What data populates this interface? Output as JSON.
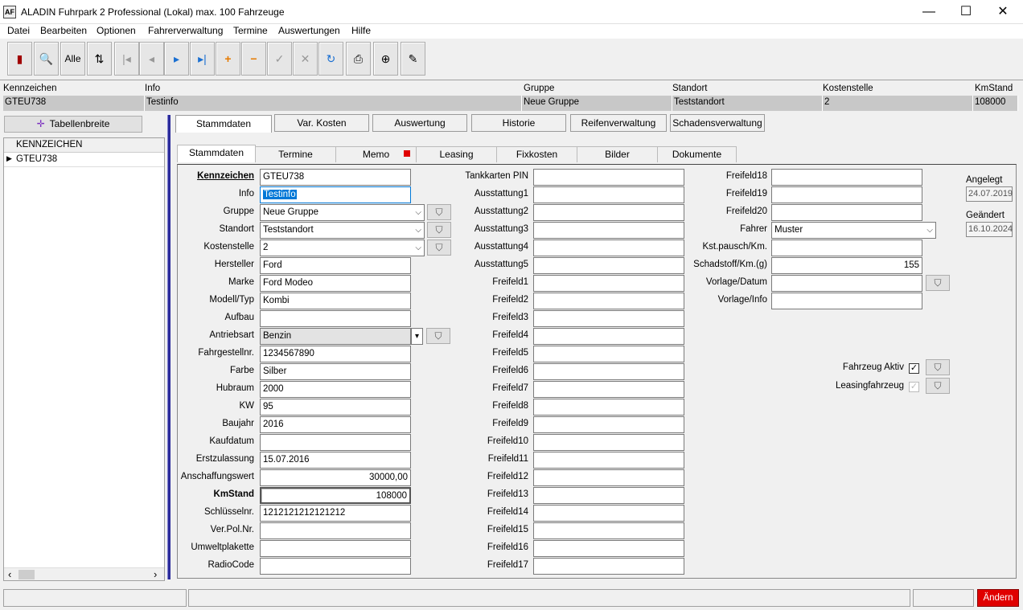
{
  "window": {
    "logo": "AF",
    "title": "ALADIN Fuhrpark 2 Professional (Lokal)  max. 100 Fahrzeuge",
    "min_icon": "—",
    "max_icon": "☐",
    "close_icon": "✕"
  },
  "menu": [
    "Datei",
    "Bearbeiten",
    "Optionen",
    "Fahrerverwaltung",
    "Termine",
    "Auswertungen",
    "Hilfe"
  ],
  "toolbar": {
    "exit_icon": "▮",
    "search_icon": "🔍",
    "all_label": "Alle",
    "sort_icon": "⇅",
    "first_icon": "|◂",
    "prev_icon": "◂",
    "next_icon": "▸",
    "last_icon": "▸|",
    "add_icon": "+",
    "remove_icon": "−",
    "confirm_icon": "✓",
    "cancel_icon": "✕",
    "refresh_icon": "↻",
    "print_icon": "⎙",
    "zoom_icon": "⊕",
    "edit_icon": "✎"
  },
  "header": {
    "labels": [
      "Kennzeichen",
      "Info",
      "Gruppe",
      "Standort",
      "Kostenstelle",
      "KmStand"
    ],
    "values": [
      "GTEU738",
      "Testinfo",
      "Neue Gruppe",
      "Teststandort",
      "2",
      "108000"
    ]
  },
  "left": {
    "tabwidth_label": "Tabellenbreite",
    "tabwidth_icon": "✛",
    "grid_header": "KENNZEICHEN",
    "rows": [
      "GTEU738"
    ],
    "row_marker": "▶",
    "scroll_left": "‹",
    "scroll_right": "›"
  },
  "top_tabs": [
    "Stammdaten",
    "Var. Kosten",
    "Auswertung",
    "Historie",
    "Reifenverwaltung",
    "Schadensverwaltung"
  ],
  "sub_tabs": [
    "Stammdaten",
    "Termine",
    "Memo",
    "Leasing",
    "Fixkosten",
    "Bilder",
    "Dokumente"
  ],
  "col1": [
    {
      "label": "Kennzeichen",
      "value": "GTEU738"
    },
    {
      "label": "Info",
      "value": "Testinfo"
    },
    {
      "label": "Gruppe",
      "value": "Neue Gruppe"
    },
    {
      "label": "Standort",
      "value": "Teststandort"
    },
    {
      "label": "Kostenstelle",
      "value": "2"
    },
    {
      "label": "Hersteller",
      "value": "Ford"
    },
    {
      "label": "Marke",
      "value": "Ford Modeo"
    },
    {
      "label": "Modell/Typ",
      "value": "Kombi"
    },
    {
      "label": "Aufbau",
      "value": ""
    },
    {
      "label": "Antriebsart",
      "value": "Benzin"
    },
    {
      "label": "Fahrgestellnr.",
      "value": "1234567890"
    },
    {
      "label": "Farbe",
      "value": "Silber"
    },
    {
      "label": "Hubraum",
      "value": "2000"
    },
    {
      "label": "KW",
      "value": "95"
    },
    {
      "label": "Baujahr",
      "value": "2016"
    },
    {
      "label": "Kaufdatum",
      "value": ""
    },
    {
      "label": "Erstzulassung",
      "value": "15.07.2016"
    },
    {
      "label": "Anschaffungswert",
      "value": "30000,00"
    },
    {
      "label": "KmStand",
      "value": "108000"
    },
    {
      "label": "Schlüsselnr.",
      "value": "1212121212121212"
    },
    {
      "label": "Ver.Pol.Nr.",
      "value": ""
    },
    {
      "label": "Umweltplakette",
      "value": ""
    },
    {
      "label": "RadioCode",
      "value": ""
    }
  ],
  "col2": [
    {
      "label": "Tankkarten PIN",
      "value": ""
    },
    {
      "label": "Ausstattung1",
      "value": ""
    },
    {
      "label": "Ausstattung2",
      "value": ""
    },
    {
      "label": "Ausstattung3",
      "value": ""
    },
    {
      "label": "Ausstattung4",
      "value": ""
    },
    {
      "label": "Ausstattung5",
      "value": ""
    },
    {
      "label": "Freifeld1",
      "value": ""
    },
    {
      "label": "Freifeld2",
      "value": ""
    },
    {
      "label": "Freifeld3",
      "value": ""
    },
    {
      "label": "Freifeld4",
      "value": ""
    },
    {
      "label": "Freifeld5",
      "value": ""
    },
    {
      "label": "Freifeld6",
      "value": ""
    },
    {
      "label": "Freifeld7",
      "value": ""
    },
    {
      "label": "Freifeld8",
      "value": ""
    },
    {
      "label": "Freifeld9",
      "value": ""
    },
    {
      "label": "Freifeld10",
      "value": ""
    },
    {
      "label": "Freifeld11",
      "value": ""
    },
    {
      "label": "Freifeld12",
      "value": ""
    },
    {
      "label": "Freifeld13",
      "value": ""
    },
    {
      "label": "Freifeld14",
      "value": ""
    },
    {
      "label": "Freifeld15",
      "value": ""
    },
    {
      "label": "Freifeld16",
      "value": ""
    },
    {
      "label": "Freifeld17",
      "value": ""
    }
  ],
  "col3": [
    {
      "label": "Freifeld18",
      "value": ""
    },
    {
      "label": "Freifeld19",
      "value": ""
    },
    {
      "label": "Freifeld20",
      "value": ""
    },
    {
      "label": "Fahrer",
      "value": "Muster"
    },
    {
      "label": "Kst.pausch/Km.",
      "value": ""
    },
    {
      "label": "Schadstoff/Km.(g)",
      "value": "155"
    },
    {
      "label": "Vorlage/Datum",
      "value": ""
    },
    {
      "label": "Vorlage/Info",
      "value": ""
    }
  ],
  "meta": {
    "angelegt_label": "Angelegt",
    "angelegt_value": "24.07.2019",
    "geaendert_label": "Geändert",
    "geaendert_value": "16.10.2024"
  },
  "flags": {
    "aktiv_label": "Fahrzeug Aktiv",
    "leasing_label": "Leasingfahrzeug",
    "check": "✓"
  },
  "icons": {
    "filter": "⛉",
    "chevron": "⌵",
    "dropdown_arrow": "▾"
  },
  "status": {
    "aendern_label": "Ändern"
  },
  "colors": {
    "accent_red": "#e00000",
    "selection_blue": "#0078d7",
    "vertical_bar": "#2b2b9b"
  }
}
